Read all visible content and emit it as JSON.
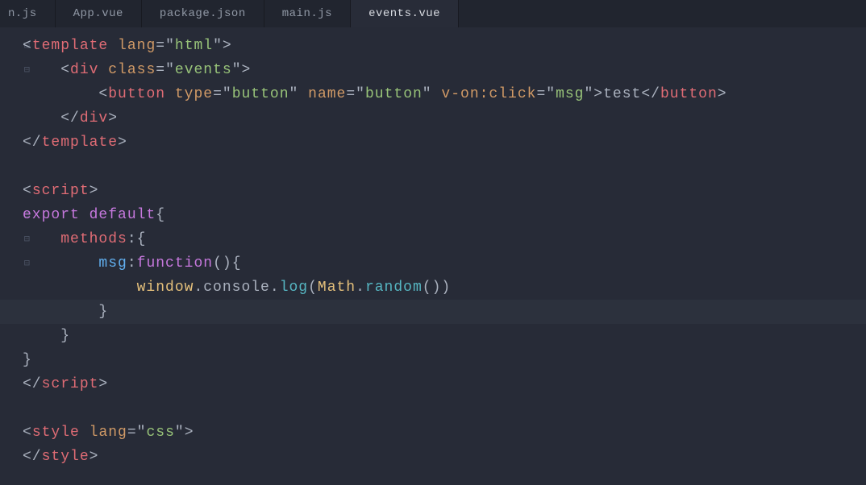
{
  "tabs": [
    {
      "label": "n.js",
      "active": false
    },
    {
      "label": "App.vue",
      "active": false
    },
    {
      "label": "package.json",
      "active": false
    },
    {
      "label": "main.js",
      "active": false
    },
    {
      "label": "events.vue",
      "active": true
    }
  ],
  "tokens": {
    "lt": "<",
    "gt": ">",
    "lt_sl": "</",
    "sp": " ",
    "eq": "=",
    "q": "\"",
    "ob": "{",
    "cb": "}",
    "op": "(",
    "cp": ")",
    "colon": ":",
    "soc": "v-on:click",
    "dot": ".",
    "template": "template",
    "lang": "lang",
    "html": "html",
    "div": "div",
    "class": "class",
    "events": "events",
    "button": "button",
    "type": "type",
    "name": "name",
    "msg": "msg",
    "test": "test",
    "script": "script",
    "export": "export",
    "default": "default",
    "methods": "methods",
    "function": "function",
    "window": "window",
    "console": "console",
    "log": "log",
    "Math": "Math",
    "random": "random",
    "style": "style",
    "css": "css",
    "ind1": "    ",
    "ind2": "        ",
    "ind3": "            ",
    "ind4": "                "
  },
  "fold": "⊟",
  "current_line_index": 11
}
